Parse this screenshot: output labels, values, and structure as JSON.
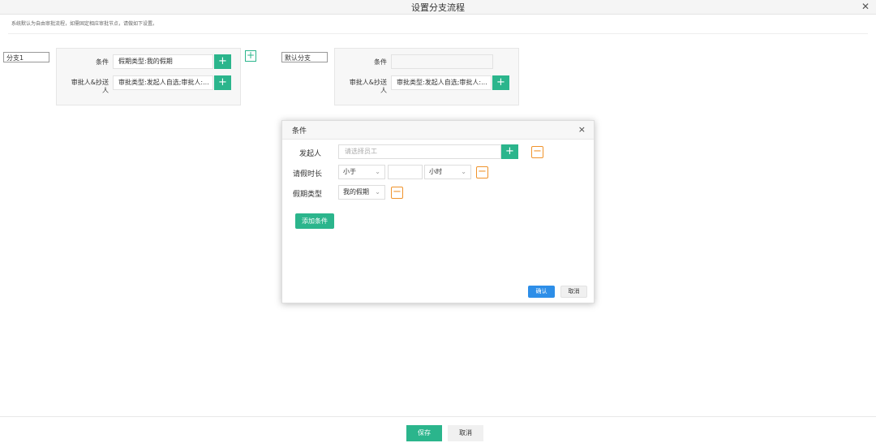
{
  "header": {
    "title": "设置分支流程",
    "close_icon": "close-icon"
  },
  "hint": "系统默认为自由审批流程，如需固定相应审批节点，请做如下设置。",
  "branches": [
    {
      "name": "分支1",
      "condition_label": "条件",
      "condition_value": "假期类型:我的假期",
      "approver_label_line1": "审批人&抄送",
      "approver_label_line2": "人",
      "approver_value": "审批类型:发起人自选;审批人:..."
    },
    {
      "name": "默认分支",
      "condition_label": "条件",
      "condition_value": "",
      "approver_label_line1": "审批人&抄送",
      "approver_label_line2": "人",
      "approver_value": "审批类型:发起人自选;审批人:..."
    }
  ],
  "add_branch_symbol": "+",
  "plus_symbol": "+",
  "minus_symbol": "−",
  "dialog": {
    "title": "条件",
    "close_symbol": "×",
    "rows": {
      "initiator_label": "发起人",
      "initiator_placeholder": "请选择员工",
      "leave_duration_label": "请假时长",
      "comparison_value": "小于",
      "duration_value": "",
      "unit_value": "小时",
      "leave_type_label": "假期类型",
      "leave_type_value": "我的假期"
    },
    "add_condition_label": "添加条件",
    "confirm_label": "确认",
    "cancel_label": "取消"
  },
  "footer": {
    "save_label": "保存",
    "cancel_label": "取消"
  },
  "colors": {
    "primary_green": "#2bb58c",
    "confirm_blue": "#2d8ee8",
    "minus_orange": "#f0932b"
  }
}
